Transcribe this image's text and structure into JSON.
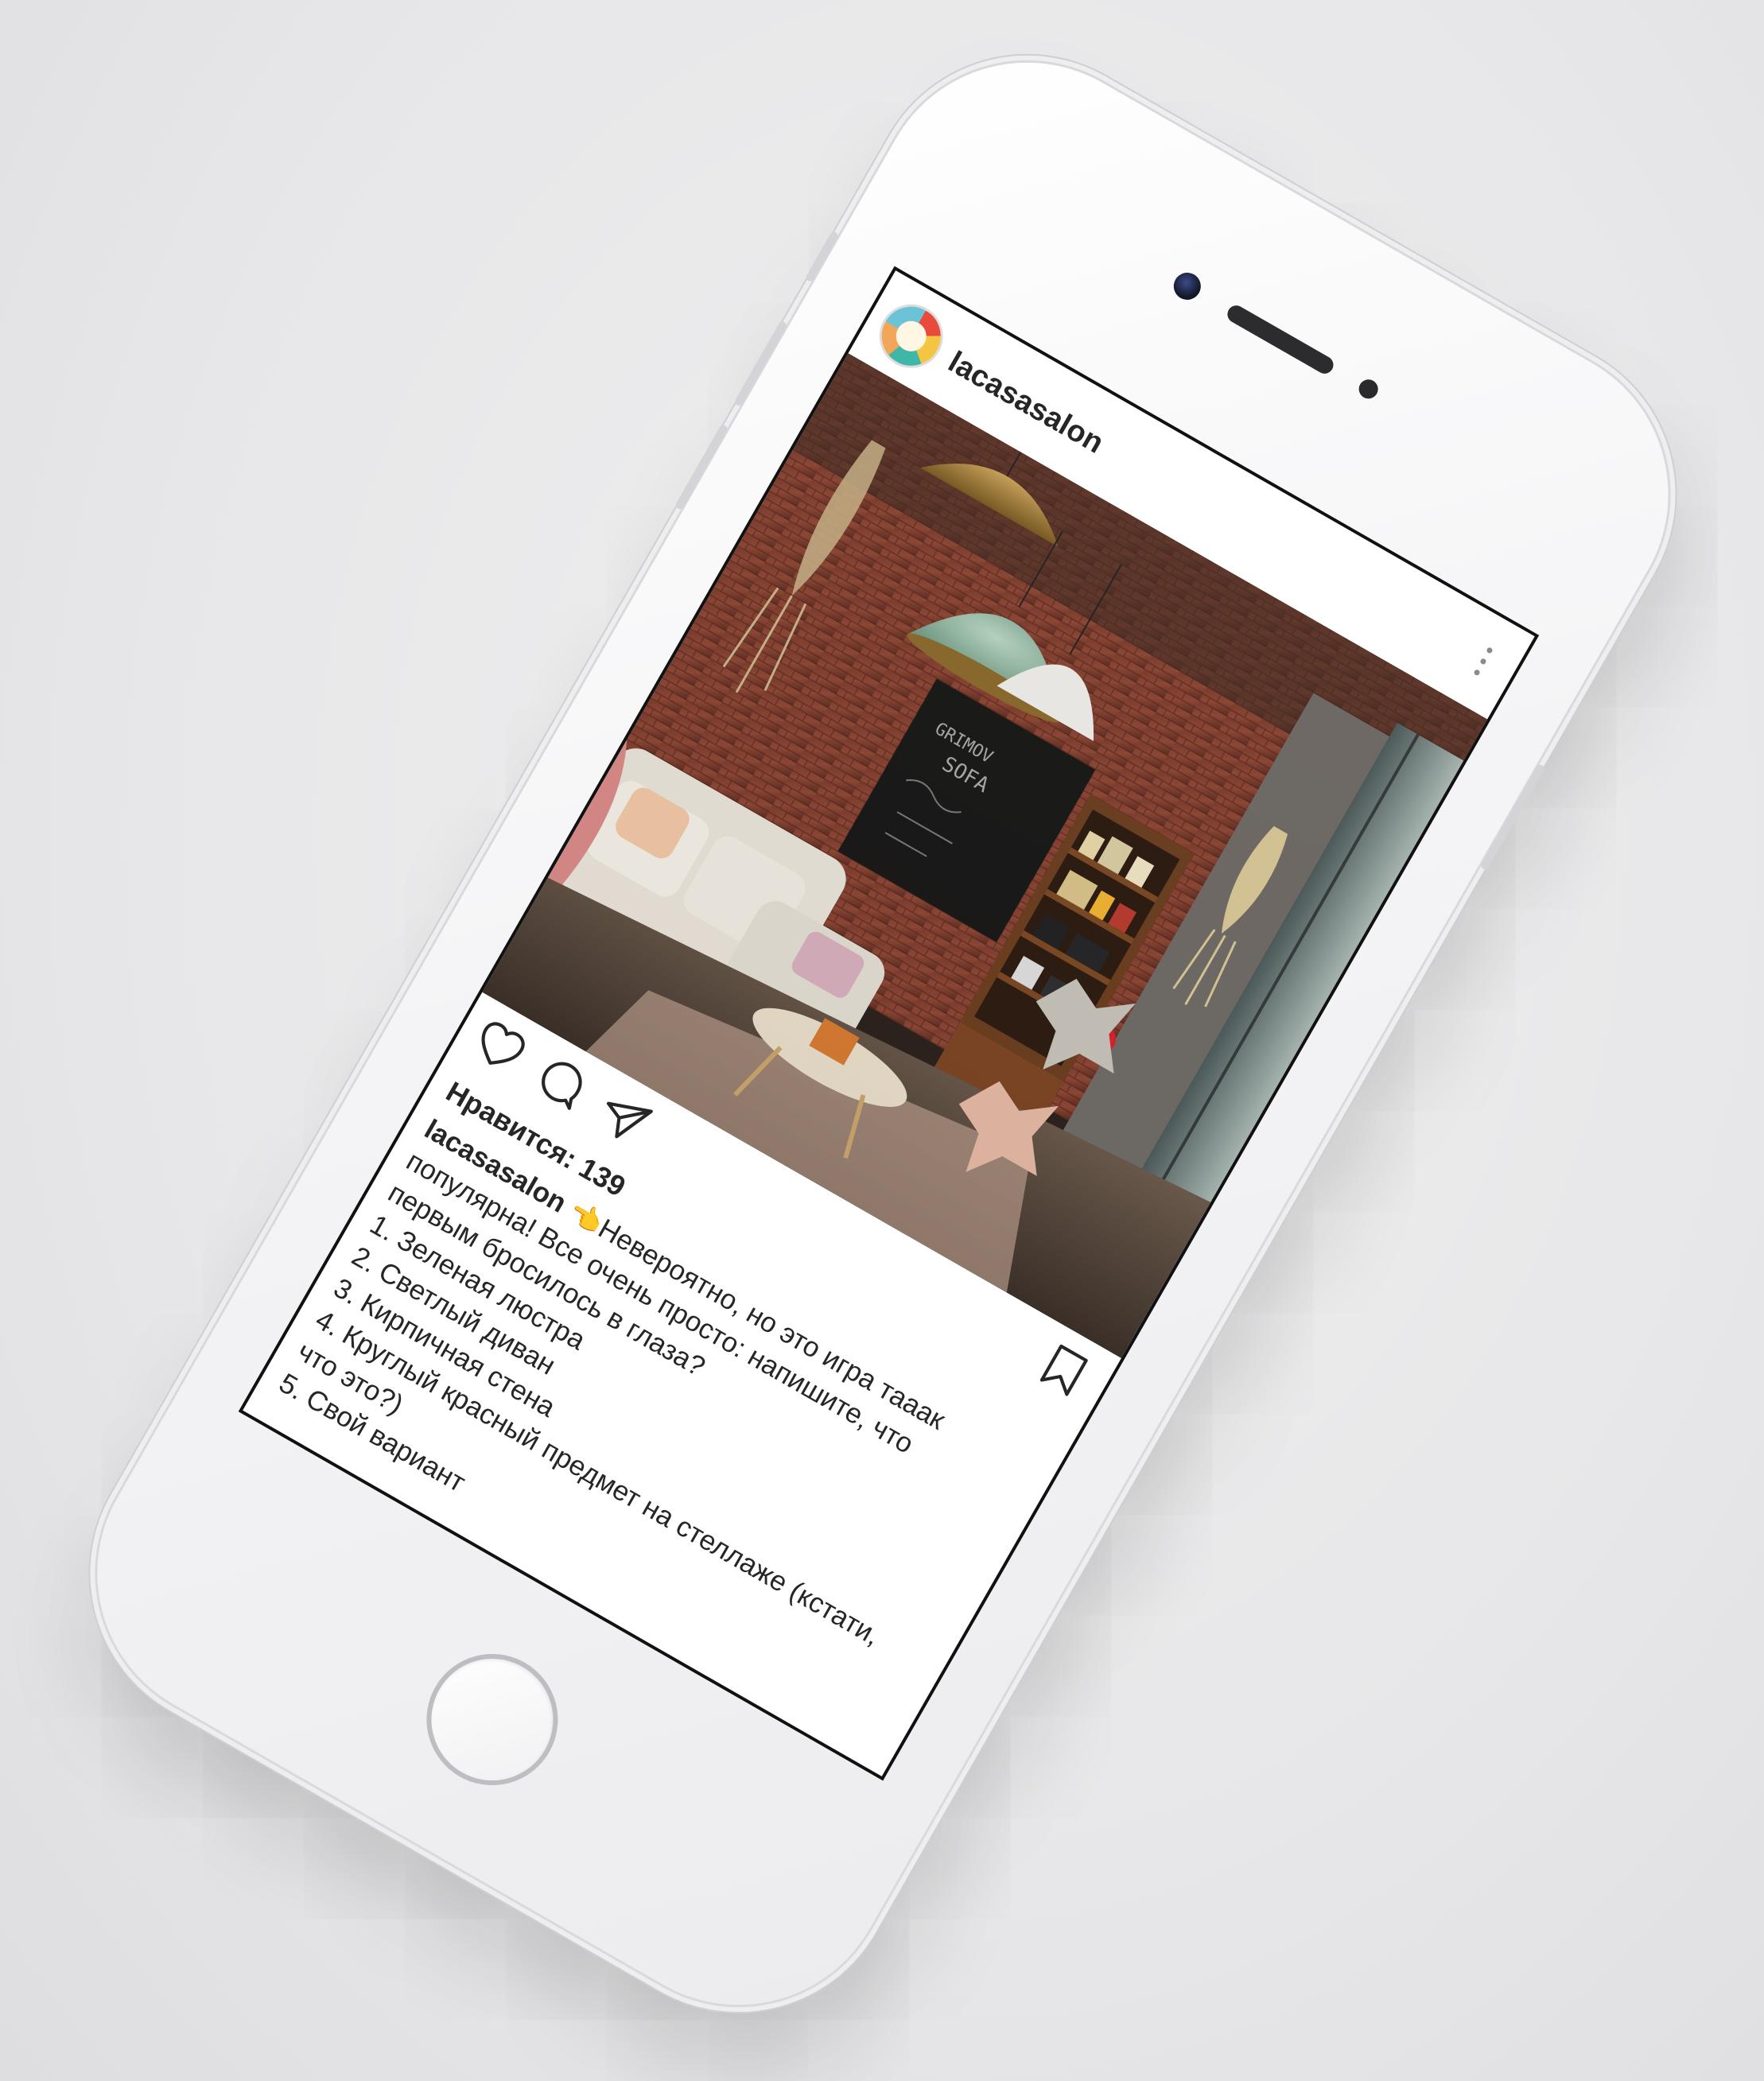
{
  "post": {
    "username": "lacasasalon",
    "likes": "Нравится: 139",
    "caption_user": "lacasasalon",
    "caption_emoji": "👈",
    "caption_lines": [
      "Невероятно, но это игра тааак",
      "популярна! Все очень просто: напишите, что",
      "первым бросилось в глаза?",
      "1. Зеленая люстра",
      "2. Светлый диван",
      "3. Кирпичная стена",
      "4. Круглый красный предмет на стеллаже (кстати,",
      "что это?)",
      "5. Свой вариант"
    ]
  },
  "icons": {
    "more": "more-vertical-icon",
    "like": "heart-icon",
    "comment": "comment-icon",
    "share": "send-icon",
    "save": "bookmark-icon"
  },
  "colors": {
    "text": "#262626",
    "pointer_emoji": "#f2a900",
    "background": "#e9e9eb"
  }
}
